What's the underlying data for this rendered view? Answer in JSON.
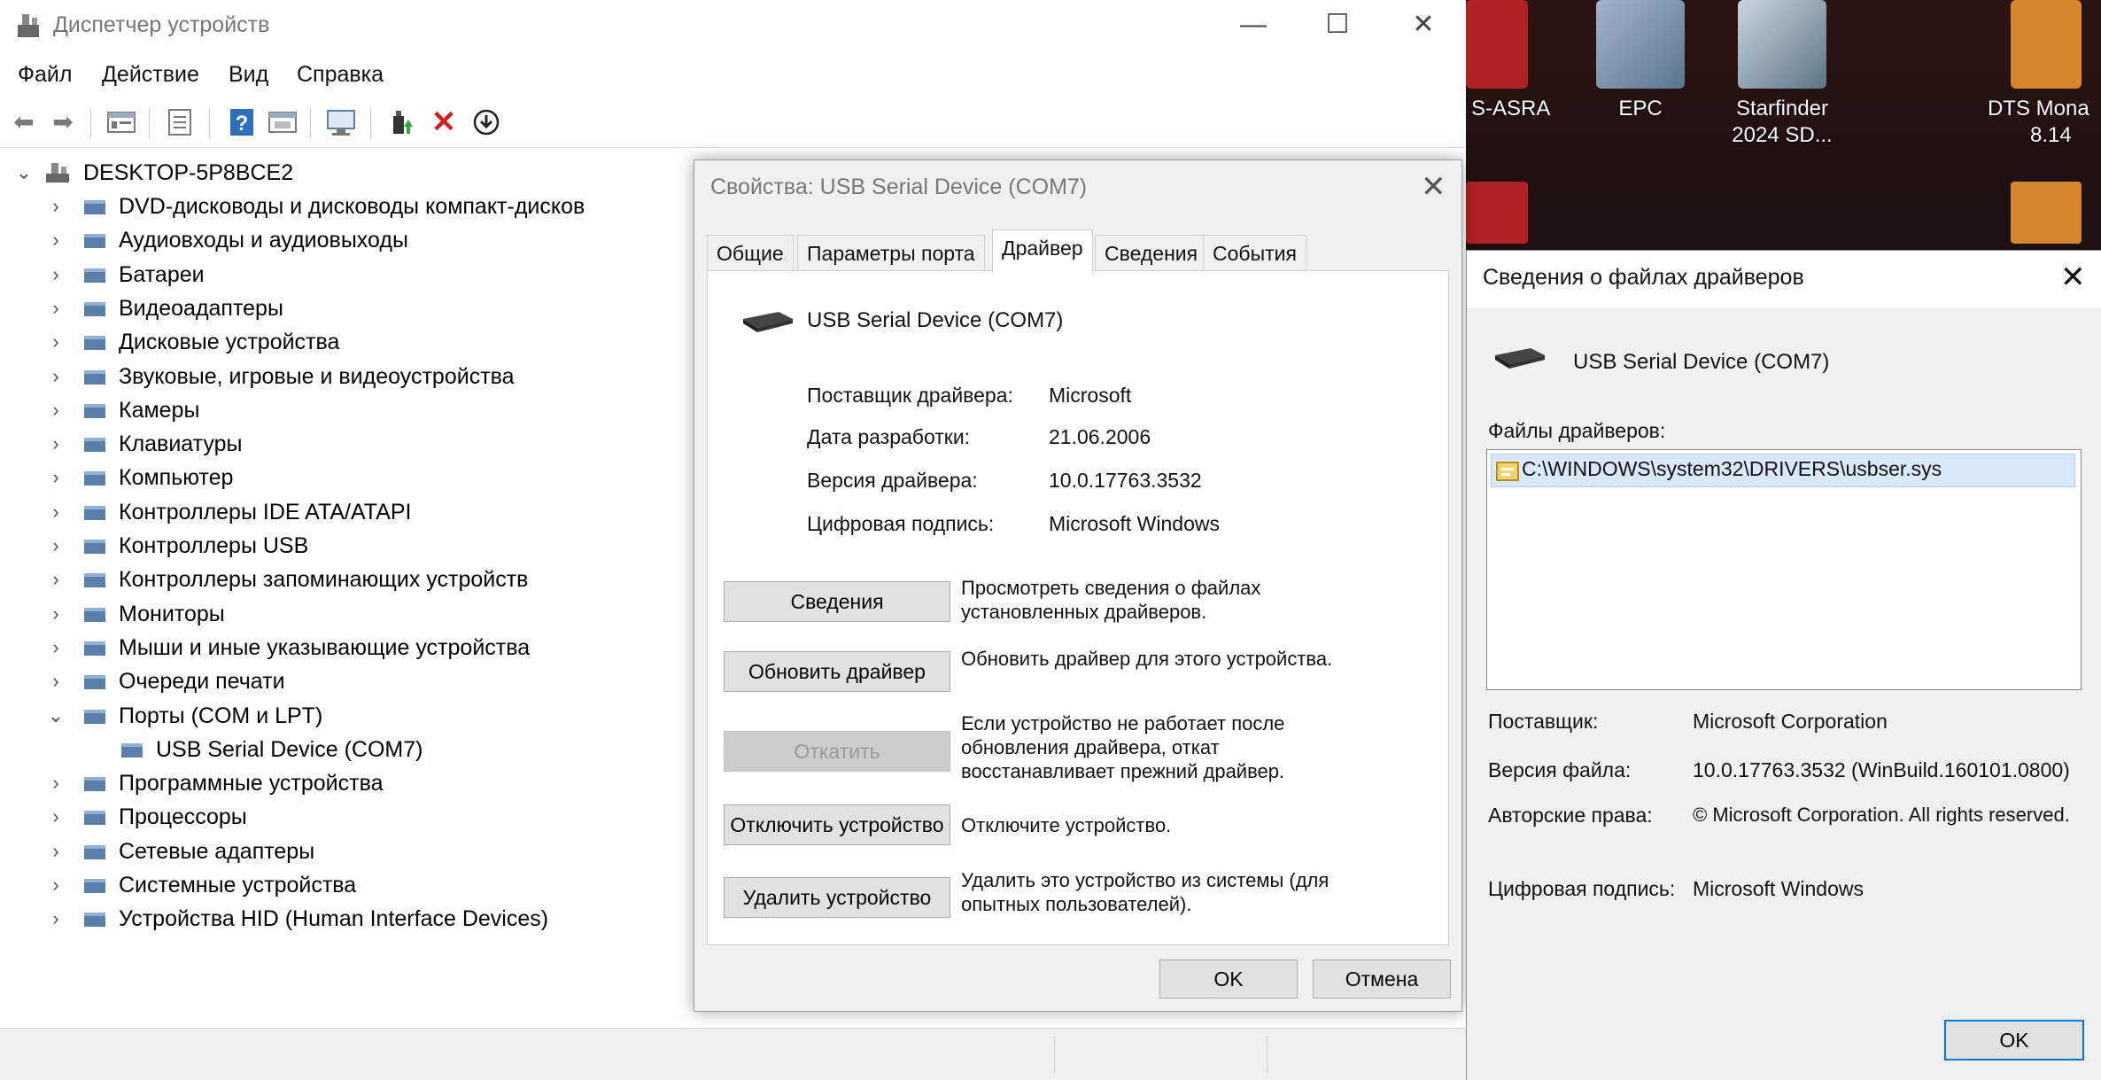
{
  "desktop": {
    "icons": [
      {
        "label_line1": "S-ASRA",
        "label_line2": ""
      },
      {
        "label_line1": "EPC",
        "label_line2": ""
      },
      {
        "label_line1": "Starfinder",
        "label_line2": "2024 SD..."
      },
      {
        "label_line1": "DTS Mona",
        "label_line2": "8.14"
      }
    ]
  },
  "device_manager": {
    "title": "Диспетчер устройств",
    "window_controls": {
      "minimize": "—",
      "maximize": "☐",
      "close": "✕"
    },
    "menu": [
      "Файл",
      "Действие",
      "Вид",
      "Справка"
    ],
    "toolbar_icons": [
      "back-icon",
      "forward-icon",
      "properties-view-icon",
      "details-icon",
      "help-icon",
      "update-view-icon",
      "scan-hardware-icon",
      "enable-device-icon",
      "remove-device-icon",
      "download-driver-icon"
    ],
    "root": "DESKTOP-5P8BCE2",
    "categories": [
      {
        "label": "DVD-дисководы и дисководы компакт-дисков",
        "icon": "dvd-drive-icon"
      },
      {
        "label": "Аудиовходы и аудиовыходы",
        "icon": "speaker-icon"
      },
      {
        "label": "Батареи",
        "icon": "battery-icon"
      },
      {
        "label": "Видеоадаптеры",
        "icon": "display-adapter-icon"
      },
      {
        "label": "Дисковые устройства",
        "icon": "disk-drive-icon"
      },
      {
        "label": "Звуковые, игровые и видеоустройства",
        "icon": "sound-icon"
      },
      {
        "label": "Камеры",
        "icon": "camera-icon"
      },
      {
        "label": "Клавиатуры",
        "icon": "keyboard-icon"
      },
      {
        "label": "Компьютер",
        "icon": "computer-icon"
      },
      {
        "label": "Контроллеры IDE ATA/ATAPI",
        "icon": "ide-controller-icon"
      },
      {
        "label": "Контроллеры USB",
        "icon": "usb-icon"
      },
      {
        "label": "Контроллеры запоминающих устройств",
        "icon": "storage-controller-icon"
      },
      {
        "label": "Мониторы",
        "icon": "monitor-icon"
      },
      {
        "label": "Мыши и иные указывающие устройства",
        "icon": "mouse-icon"
      },
      {
        "label": "Очереди печати",
        "icon": "printer-icon"
      },
      {
        "label": "Порты (COM и LPT)",
        "icon": "port-icon",
        "expanded": true
      },
      {
        "label": "USB Serial Device (COM7)",
        "icon": "port-icon",
        "child": true
      },
      {
        "label": "Программные устройства",
        "icon": "software-device-icon"
      },
      {
        "label": "Процессоры",
        "icon": "processor-icon"
      },
      {
        "label": "Сетевые адаптеры",
        "icon": "network-adapter-icon"
      },
      {
        "label": "Системные устройства",
        "icon": "system-device-icon"
      },
      {
        "label": "Устройства HID (Human Interface Devices)",
        "icon": "hid-icon"
      }
    ]
  },
  "properties_dialog": {
    "title": "Свойства: USB Serial Device (COM7)",
    "tabs": [
      "Общие",
      "Параметры порта",
      "Драйвер",
      "Сведения",
      "События"
    ],
    "active_tab": "Драйвер",
    "device_name": "USB Serial Device (COM7)",
    "fields": [
      {
        "label": "Поставщик драйвера:",
        "value": "Microsoft"
      },
      {
        "label": "Дата разработки:",
        "value": "21.06.2006"
      },
      {
        "label": "Версия драйвера:",
        "value": "10.0.17763.3532"
      },
      {
        "label": "Цифровая подпись:",
        "value": "Microsoft Windows"
      }
    ],
    "actions": [
      {
        "button": "Сведения",
        "desc1": "Просмотреть сведения о файлах",
        "desc2": "установленных драйверов.",
        "desc3": "",
        "enabled": true
      },
      {
        "button": "Обновить драйвер",
        "desc1": "Обновить драйвер для этого устройства.",
        "desc2": "",
        "desc3": "",
        "enabled": true
      },
      {
        "button": "Откатить",
        "desc1": "Если устройство не работает после",
        "desc2": "обновления драйвера, откат",
        "desc3": "восстанавливает прежний драйвер.",
        "enabled": false
      },
      {
        "button": "Отключить устройство",
        "desc1": "Отключите устройство.",
        "desc2": "",
        "desc3": "",
        "enabled": true
      },
      {
        "button": "Удалить устройство",
        "desc1": "Удалить это устройство из системы (для",
        "desc2": "опытных пользователей).",
        "desc3": "",
        "enabled": true
      }
    ],
    "ok": "OK",
    "cancel": "Отмена"
  },
  "driver_files_dialog": {
    "title": "Сведения о файлах драйверов",
    "device_name": "USB Serial Device (COM7)",
    "files_label": "Файлы драйверов:",
    "files": [
      "C:\\WINDOWS\\system32\\DRIVERS\\usbser.sys"
    ],
    "details": [
      {
        "label": "Поставщик:",
        "value": "Microsoft Corporation"
      },
      {
        "label": "Версия файла:",
        "value": "10.0.17763.3532 (WinBuild.160101.0800)"
      },
      {
        "label": "Авторские права:",
        "value": "© Microsoft Corporation. All rights reserved."
      },
      {
        "label": "Цифровая подпись:",
        "value": "Microsoft Windows"
      }
    ],
    "ok": "OK"
  }
}
